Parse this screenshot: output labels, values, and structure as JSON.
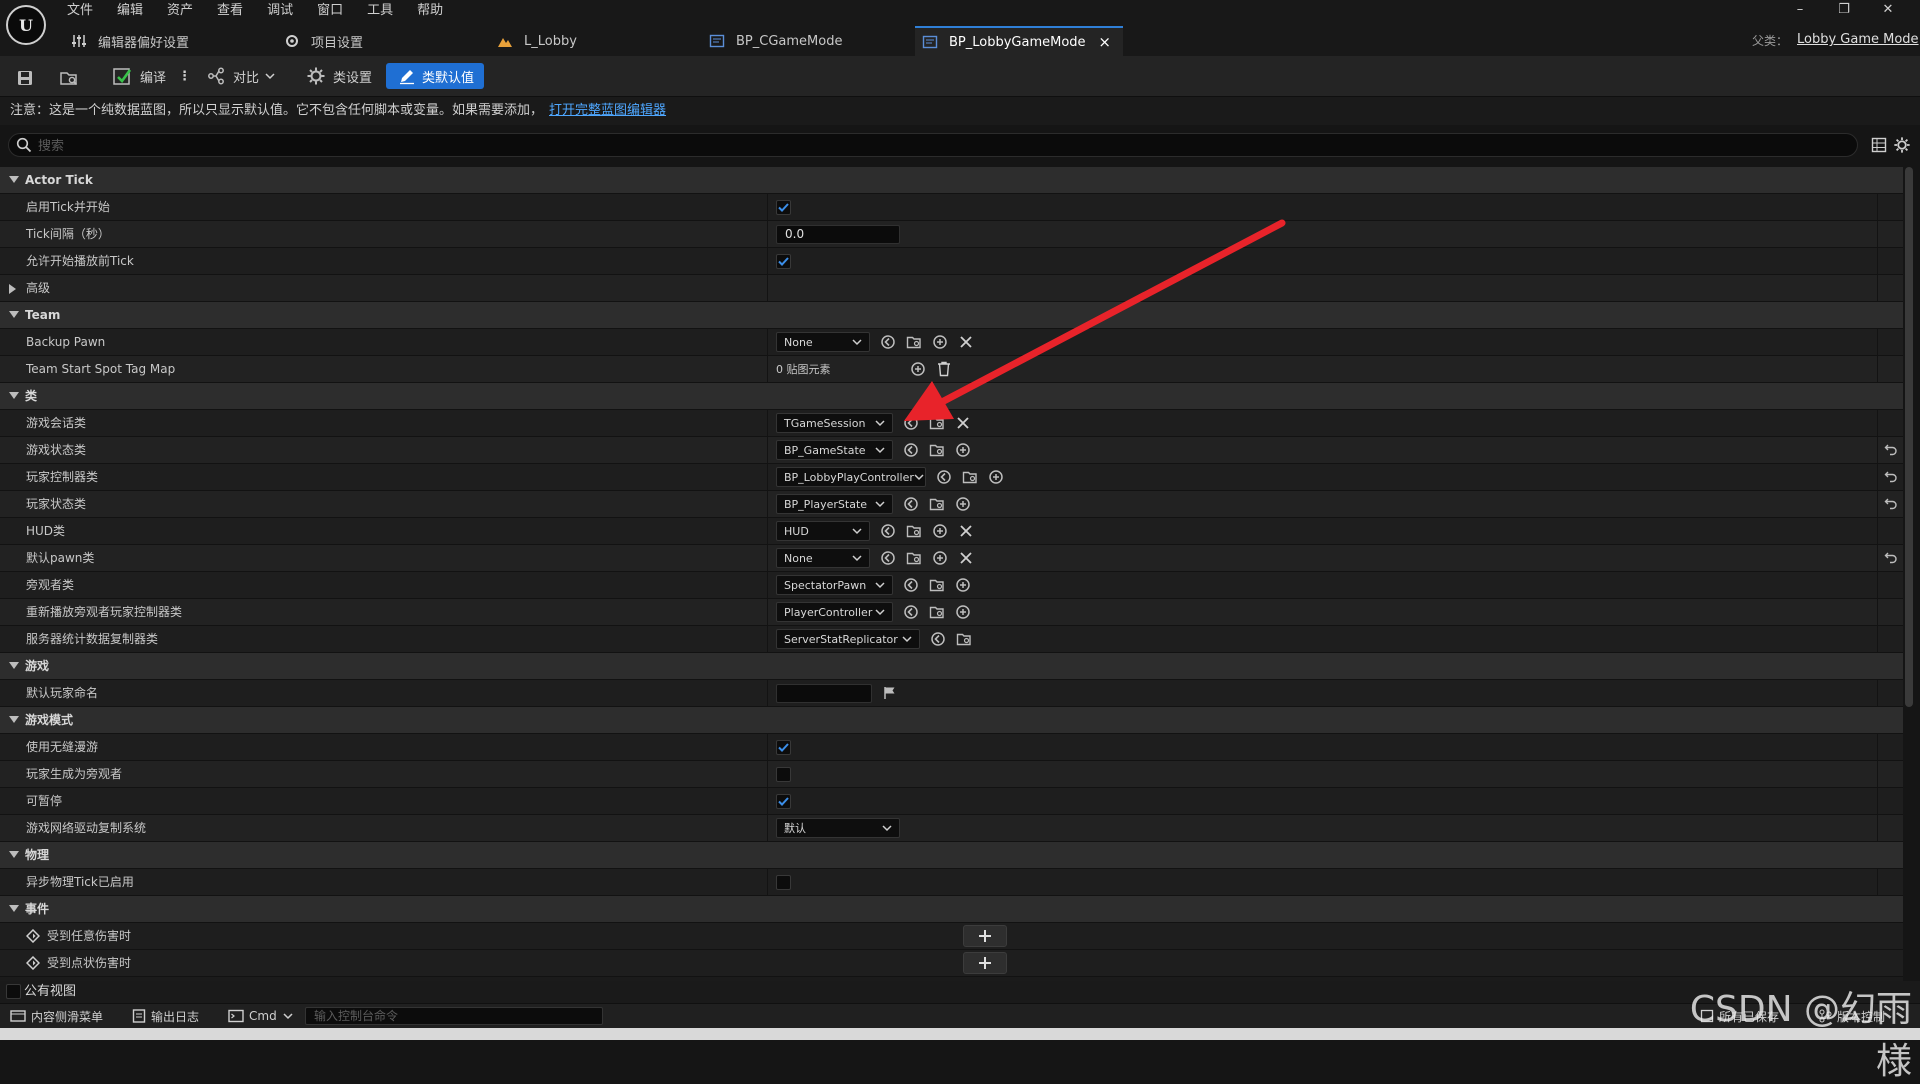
{
  "menu": [
    "文件",
    "编辑",
    "资产",
    "查看",
    "调试",
    "窗口",
    "工具",
    "帮助"
  ],
  "tabs": [
    {
      "label": "编辑器偏好设置",
      "icon": "sliders-icon"
    },
    {
      "label": "项目设置",
      "icon": "project-settings-icon"
    },
    {
      "label": "L_Lobby",
      "icon": "level-icon"
    },
    {
      "label": "BP_CGameMode",
      "icon": "blueprint-icon"
    },
    {
      "label": "BP_LobbyGameMode",
      "icon": "blueprint-icon",
      "close": "×"
    }
  ],
  "window_controls": [
    "–",
    "❐",
    "✕"
  ],
  "parent": {
    "label": "父类：",
    "value": "Lobby Game Mode"
  },
  "toolbar": {
    "compile": "编译",
    "diff": "对比",
    "class_settings": "类设置",
    "class_defaults": "类默认值"
  },
  "notice": {
    "text": "注意：这是一个纯数据蓝图，所以只显示默认值。它不包含任何脚本或变量。如果需要添加，",
    "link": "打开完整蓝图编辑器"
  },
  "search": {
    "placeholder": "搜索"
  },
  "categories": {
    "actor_tick": "Actor Tick",
    "advanced": "高级",
    "team": "Team",
    "classes": "类",
    "game": "游戏",
    "game_mode": "游戏模式",
    "physics": "物理",
    "events": "事件"
  },
  "props": {
    "tick_start": {
      "label": "启用Tick并开始",
      "checked": true
    },
    "tick_interval": {
      "label": "Tick间隔（秒）",
      "value": "0.0"
    },
    "tick_before_play": {
      "label": "允许开始播放前Tick",
      "checked": true
    },
    "backup_pawn": {
      "label": "Backup Pawn",
      "value": "None"
    },
    "team_start_map": {
      "label": "Team Start Spot Tag Map",
      "value": "0 贴图元素"
    },
    "game_session": {
      "label": "游戏会话类",
      "value": "TGameSession"
    },
    "game_state": {
      "label": "游戏状态类",
      "value": "BP_GameState"
    },
    "player_controller": {
      "label": "玩家控制器类",
      "value": "BP_LobbyPlayController"
    },
    "player_state": {
      "label": "玩家状态类",
      "value": "BP_PlayerState"
    },
    "hud": {
      "label": "HUD类",
      "value": "HUD"
    },
    "default_pawn": {
      "label": "默认pawn类",
      "value": "None"
    },
    "spectator": {
      "label": "旁观者类",
      "value": "SpectatorPawn"
    },
    "replay_spectator": {
      "label": "重新播放旁观者玩家控制器类",
      "value": "PlayerController"
    },
    "server_stat": {
      "label": "服务器统计数据复制器类",
      "value": "ServerStatReplicator"
    },
    "default_player_name": {
      "label": "默认玩家命名",
      "value": ""
    },
    "seamless_travel": {
      "label": "使用无缝漫游",
      "checked": true
    },
    "start_spectator": {
      "label": "玩家生成为旁观者",
      "checked": false
    },
    "pausable": {
      "label": "可暂停",
      "checked": true
    },
    "net_replication": {
      "label": "游戏网络驱动复制系统",
      "value": "默认"
    },
    "async_physics": {
      "label": "异步物理Tick已启用",
      "checked": false
    },
    "any_damage": {
      "label": "受到任意伤害时"
    },
    "point_damage": {
      "label": "受到点状伤害时"
    }
  },
  "public_view": "公有视图",
  "statusbar": {
    "content_drawer": "内容侧滑菜单",
    "output_log": "输出日志",
    "cmd": "Cmd",
    "console_placeholder": "输入控制台命令",
    "all_saved": "所有已保存",
    "revision": "版本控制"
  },
  "watermark": "CSDN @幻雨様",
  "colors": {
    "accent": "#1f6fd3",
    "arrow": "#e8232a",
    "check": "#3b8ee8"
  }
}
